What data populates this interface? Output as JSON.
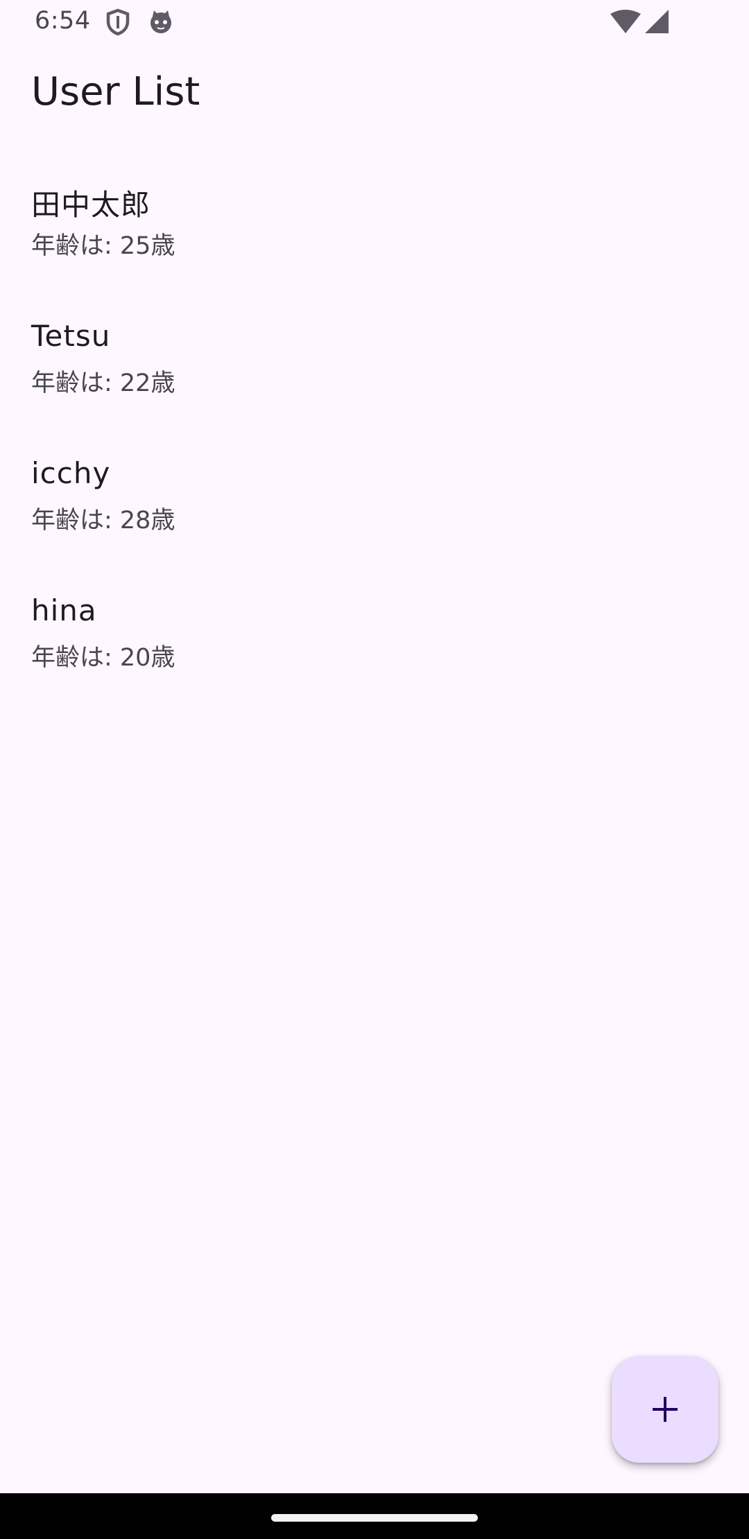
{
  "status_bar": {
    "time": "6:54",
    "icons": [
      "shield-icon",
      "cat-face-icon",
      "wifi-icon",
      "cellular-signal-icon"
    ]
  },
  "app": {
    "title": "User List"
  },
  "users": [
    {
      "name": "田中太郎",
      "age_text": "年齢は: 25歳"
    },
    {
      "name": "Tetsu",
      "age_text": "年齢は: 22歳"
    },
    {
      "name": "icchy",
      "age_text": "年齢は: 28歳"
    },
    {
      "name": "hina",
      "age_text": "年齢は: 20歳"
    }
  ],
  "fab": {
    "icon": "plus-icon"
  },
  "colors": {
    "background": "#FEF7FF",
    "fab_container": "#EADDFF",
    "fab_icon": "#21005D",
    "primary_text": "#1D1B20",
    "secondary_text": "#49454F"
  }
}
